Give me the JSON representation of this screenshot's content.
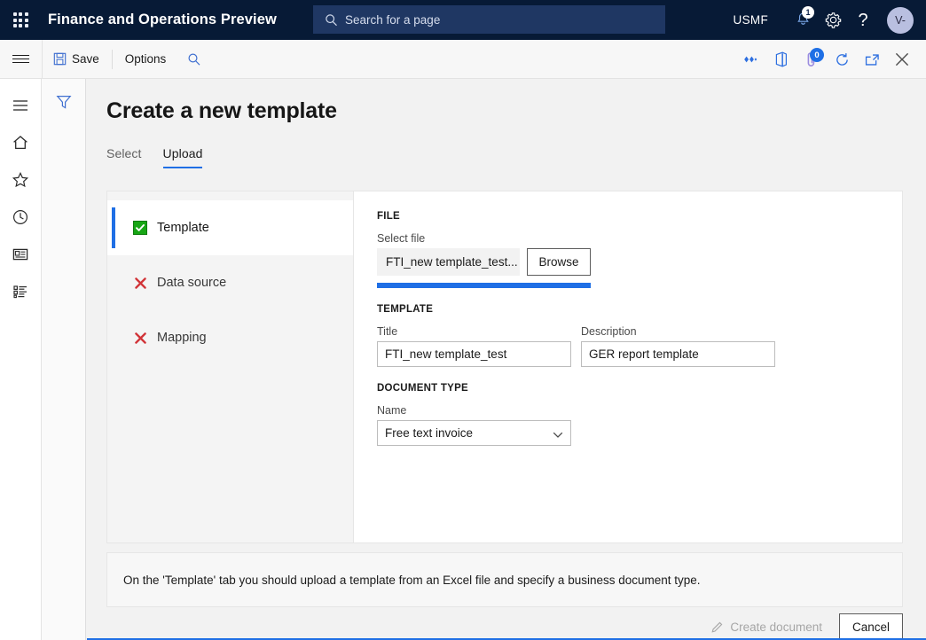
{
  "topbar": {
    "waffle_label": "App launcher",
    "brand": "Finance and Operations Preview",
    "search_placeholder": "Search for a page",
    "company": "USMF",
    "notification_count": "1",
    "avatar_initials": "V-"
  },
  "commandbar": {
    "save_label": "Save",
    "options_label": "Options",
    "attachment_count": "0"
  },
  "page": {
    "title": "Create a new template",
    "tabs": [
      {
        "label": "Select",
        "active": false
      },
      {
        "label": "Upload",
        "active": true
      }
    ]
  },
  "wizard": {
    "steps": [
      {
        "label": "Template",
        "status": "ok",
        "active": true
      },
      {
        "label": "Data source",
        "status": "error",
        "active": false
      },
      {
        "label": "Mapping",
        "status": "error",
        "active": false
      }
    ]
  },
  "file_section": {
    "group_label": "FILE",
    "select_file_label": "Select file",
    "file_name": "FTI_new template_test...",
    "browse_label": "Browse",
    "progress_percent": 100
  },
  "template_section": {
    "group_label": "TEMPLATE",
    "title_label": "Title",
    "title_value": "FTI_new template_test",
    "description_label": "Description",
    "description_value": "GER report template"
  },
  "document_type_section": {
    "group_label": "DOCUMENT TYPE",
    "name_label": "Name",
    "name_value": "Free text invoice",
    "options": [
      "Free text invoice"
    ]
  },
  "info_bar": {
    "message": "On the 'Template' tab you should upload a template from an Excel file and specify a business document type."
  },
  "footer": {
    "create_document_label": "Create document",
    "cancel_label": "Cancel"
  },
  "colors": {
    "header_navy": "#071a36",
    "search_navy": "#1f3763",
    "accent_blue": "#1f6fe5",
    "success_green": "#17a615",
    "error_red": "#d13438",
    "workspace_gray": "#f2f2f2"
  }
}
